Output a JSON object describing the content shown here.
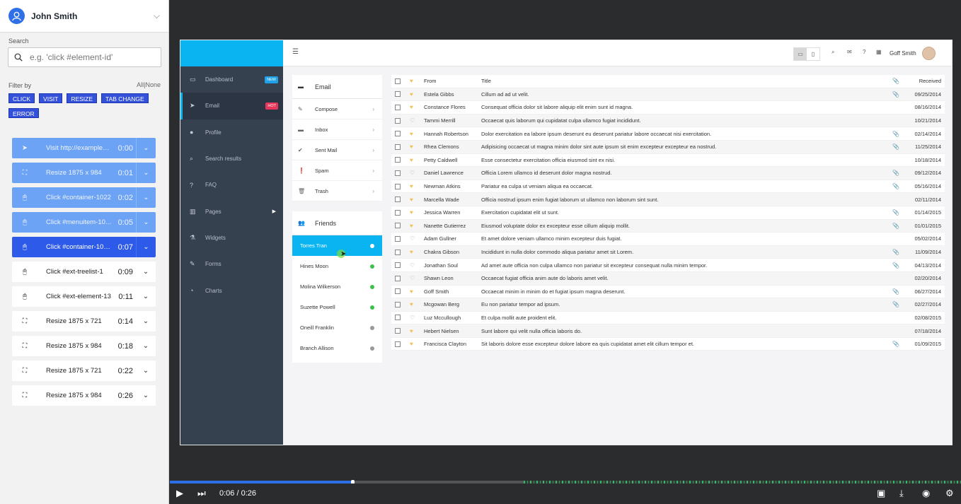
{
  "user": {
    "name": "John Smith"
  },
  "search": {
    "label": "Search",
    "placeholder": "e.g. 'click #element-id'"
  },
  "filter": {
    "label": "Filter by",
    "all": "All",
    "sep": "|",
    "none": "None",
    "buttons": [
      "CLICK",
      "VISIT",
      "RESIZE",
      "TAB CHANGE",
      "ERROR"
    ]
  },
  "events": [
    {
      "icon": "navigation-arrow-icon",
      "label": "Visit http://examples....",
      "time": "0:00",
      "state": "done"
    },
    {
      "icon": "resize-icon",
      "label": "Resize 1875 x 984",
      "time": "0:01",
      "state": "done"
    },
    {
      "icon": "mouse-icon",
      "label": "Click #container-1022",
      "time": "0:02",
      "state": "done"
    },
    {
      "icon": "mouse-icon",
      "label": "Click #menuitem-10...",
      "time": "0:05",
      "state": "done"
    },
    {
      "icon": "mouse-icon",
      "label": "Click #container-103...",
      "time": "0:07",
      "state": "current"
    },
    {
      "icon": "mouse-icon",
      "label": "Click #ext-treelist-1",
      "time": "0:09",
      "state": "future"
    },
    {
      "icon": "mouse-icon",
      "label": "Click #ext-element-13",
      "time": "0:11",
      "state": "future"
    },
    {
      "icon": "resize-icon",
      "label": "Resize 1875 x 721",
      "time": "0:14",
      "state": "future"
    },
    {
      "icon": "resize-icon",
      "label": "Resize 1875 x 984",
      "time": "0:18",
      "state": "future"
    },
    {
      "icon": "resize-icon",
      "label": "Resize 1875 x 721",
      "time": "0:22",
      "state": "future"
    },
    {
      "icon": "resize-icon",
      "label": "Resize 1875 x 984",
      "time": "0:26",
      "state": "future"
    }
  ],
  "app": {
    "user": "Goff Smith",
    "nav": [
      {
        "label": "Dashboard",
        "icon": "monitor-icon",
        "badge": "NEW",
        "badge_color": "#1ea1e6"
      },
      {
        "label": "Email",
        "icon": "send-icon",
        "badge": "HOT",
        "badge_color": "#e8365a",
        "active": true
      },
      {
        "label": "Profile",
        "icon": "user-icon"
      },
      {
        "label": "Search results",
        "icon": "search-icon"
      },
      {
        "label": "FAQ",
        "icon": "question-icon"
      },
      {
        "label": "Pages",
        "icon": "book-icon",
        "arrow": true
      },
      {
        "label": "Widgets",
        "icon": "flask-icon"
      },
      {
        "label": "Forms",
        "icon": "edit-icon"
      },
      {
        "label": "Charts",
        "icon": "pie-chart-icon"
      }
    ],
    "email_menu": {
      "title": "Email",
      "items": [
        {
          "label": "Compose",
          "icon": "compose-icon"
        },
        {
          "label": "Inbox",
          "icon": "inbox-icon"
        },
        {
          "label": "Sent Mail",
          "icon": "check-circle-icon"
        },
        {
          "label": "Spam",
          "icon": "alert-icon"
        },
        {
          "label": "Trash",
          "icon": "trash-icon"
        }
      ]
    },
    "friends": {
      "title": "Friends",
      "items": [
        {
          "name": "Torres Tran",
          "status": "#ffffff",
          "selected": true
        },
        {
          "name": "Hines Moon",
          "status": "#3bc14a"
        },
        {
          "name": "Molina Wilkerson",
          "status": "#3bc14a"
        },
        {
          "name": "Suzette Powell",
          "status": "#3bc14a"
        },
        {
          "name": "Oneill Franklin",
          "status": "#999999"
        },
        {
          "name": "Branch Allison",
          "status": "#999999"
        }
      ]
    },
    "table": {
      "headers": {
        "from": "From",
        "title": "Title",
        "received": "Received"
      },
      "rows": [
        {
          "from": "Estela Gibbs",
          "title": "Cillum ad ad ut velit.",
          "date": "09/25/2014",
          "fav": true,
          "attach": true
        },
        {
          "from": "Constance Flores",
          "title": "Consequat officia dolor sit labore aliquip elit enim sunt id magna.",
          "date": "08/16/2014",
          "fav": true,
          "attach": false
        },
        {
          "from": "Tammi Merrill",
          "title": "Occaecat quis laborum qui cupidatat culpa ullamco fugiat incididunt.",
          "date": "10/21/2014",
          "fav": false,
          "attach": false
        },
        {
          "from": "Hannah Robertson",
          "title": "Dolor exercitation ea labore ipsum deserunt eu deserunt pariatur labore occaecat nisi exercitation.",
          "date": "02/14/2014",
          "fav": true,
          "attach": true
        },
        {
          "from": "Rhea Clemons",
          "title": "Adipisicing occaecat ut magna minim dolor sint aute ipsum sit enim excepteur excepteur ea nostrud.",
          "date": "11/25/2014",
          "fav": true,
          "attach": true
        },
        {
          "from": "Petty Caldwell",
          "title": "Esse consectetur exercitation officia eiusmod sint ex nisi.",
          "date": "10/18/2014",
          "fav": true,
          "attach": false
        },
        {
          "from": "Daniel Lawrence",
          "title": "Officia Lorem ullamco id deserunt dolor magna nostrud.",
          "date": "09/12/2014",
          "fav": false,
          "attach": true
        },
        {
          "from": "Newman Atkins",
          "title": "Pariatur ea culpa ut veniam aliqua ea occaecat.",
          "date": "05/16/2014",
          "fav": true,
          "attach": true
        },
        {
          "from": "Marcella Wade",
          "title": "Officia nostrud ipsum enim fugiat laborum ut ullamco non laborum sint sunt.",
          "date": "02/11/2014",
          "fav": true,
          "attach": false
        },
        {
          "from": "Jessica Warren",
          "title": "Exercitation cupidatat elit ut sunt.",
          "date": "01/14/2015",
          "fav": true,
          "attach": true
        },
        {
          "from": "Nanette Gutierrez",
          "title": "Eiusmod voluptate dolor ex excepteur esse cillum aliquip mollit.",
          "date": "01/01/2015",
          "fav": true,
          "attach": true
        },
        {
          "from": "Adam Gullner",
          "title": "Et amet dolore veniam ullamco minim excepteur duis fugiat.",
          "date": "05/02/2014",
          "fav": false,
          "attach": false
        },
        {
          "from": "Chakra Gibson",
          "title": "Incididunt in nulla dolor commodo aliqua pariatur amet sit Lorem.",
          "date": "11/09/2014",
          "fav": true,
          "attach": true
        },
        {
          "from": "Jonathan Soul",
          "title": "Ad amet aute officia non culpa ullamco non pariatur sit excepteur consequat nulla minim tempor.",
          "date": "04/13/2014",
          "fav": false,
          "attach": true
        },
        {
          "from": "Shawn Leon",
          "title": "Occaecat fugiat officia anim aute do laboris amet velit.",
          "date": "02/20/2014",
          "fav": false,
          "attach": false
        },
        {
          "from": "Goff Smith",
          "title": "Occaecat minim in minim do et fugiat ipsum magna deserunt.",
          "date": "06/27/2014",
          "fav": true,
          "attach": true
        },
        {
          "from": "Mcgowan Berg",
          "title": "Eu non pariatur tempor ad ipsum.",
          "date": "02/27/2014",
          "fav": true,
          "attach": true
        },
        {
          "from": "Luz Mccullough",
          "title": "Et culpa mollit aute proident elit.",
          "date": "02/08/2015",
          "fav": false,
          "attach": false
        },
        {
          "from": "Hebert Nielsen",
          "title": "Sunt labore qui velit nulla officia laboris do.",
          "date": "07/18/2014",
          "fav": true,
          "attach": false
        },
        {
          "from": "Francisca Clayton",
          "title": "Sit laboris dolore esse excepteur dolore labore ea quis cupidatat amet elit cillum tempor et.",
          "date": "01/09/2015",
          "fav": true,
          "attach": true
        }
      ]
    }
  },
  "player": {
    "time": "0:06 / 0:26",
    "progress": 0.23
  }
}
